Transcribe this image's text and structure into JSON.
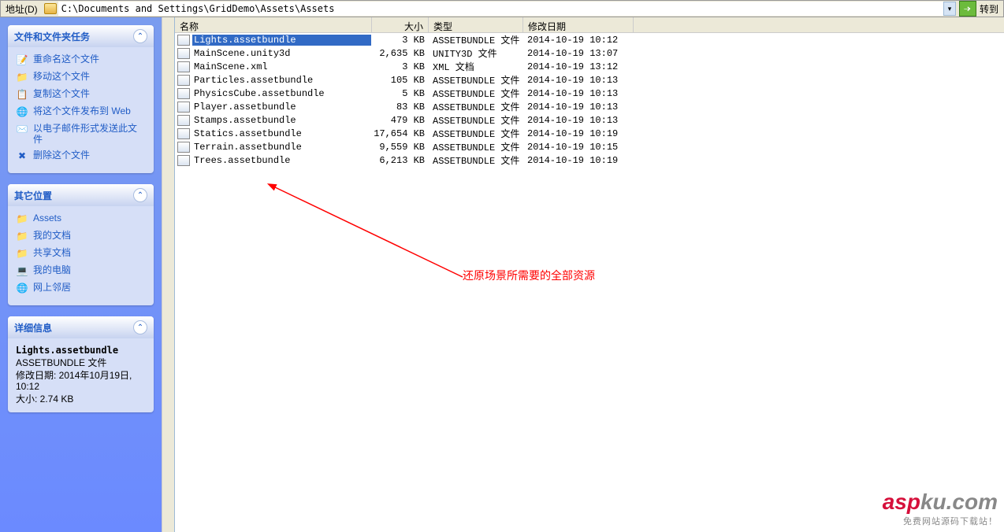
{
  "addrbar": {
    "label": "地址(D)",
    "path": "C:\\Documents and Settings\\GridDemo\\Assets\\Assets",
    "go": "转到"
  },
  "panels": {
    "tasks": {
      "title": "文件和文件夹任务",
      "items": [
        "重命名这个文件",
        "移动这个文件",
        "复制这个文件",
        "将这个文件发布到 Web",
        "以电子邮件形式发送此文件",
        "删除这个文件"
      ]
    },
    "places": {
      "title": "其它位置",
      "items": [
        "Assets",
        "我的文档",
        "共享文档",
        "我的电脑",
        "网上邻居"
      ]
    },
    "details": {
      "title": "详细信息",
      "filename": "Lights.assetbundle",
      "filetype": "ASSETBUNDLE 文件",
      "modlabel": "修改日期: 2014年10月19日, 10:12",
      "sizelabel": "大小: 2.74 KB"
    }
  },
  "columns": {
    "name": "名称",
    "size": "大小",
    "type": "类型",
    "date": "修改日期"
  },
  "files": [
    {
      "name": "Lights.assetbundle",
      "size": "3 KB",
      "type": "ASSETBUNDLE 文件",
      "date": "2014-10-19 10:12",
      "sel": true
    },
    {
      "name": "MainScene.unity3d",
      "size": "2,635 KB",
      "type": "UNITY3D 文件",
      "date": "2014-10-19 13:07"
    },
    {
      "name": "MainScene.xml",
      "size": "3 KB",
      "type": "XML 文档",
      "date": "2014-10-19 13:12"
    },
    {
      "name": "Particles.assetbundle",
      "size": "105 KB",
      "type": "ASSETBUNDLE 文件",
      "date": "2014-10-19 10:13"
    },
    {
      "name": "PhysicsCube.assetbundle",
      "size": "5 KB",
      "type": "ASSETBUNDLE 文件",
      "date": "2014-10-19 10:13"
    },
    {
      "name": "Player.assetbundle",
      "size": "83 KB",
      "type": "ASSETBUNDLE 文件",
      "date": "2014-10-19 10:13"
    },
    {
      "name": "Stamps.assetbundle",
      "size": "479 KB",
      "type": "ASSETBUNDLE 文件",
      "date": "2014-10-19 10:13"
    },
    {
      "name": "Statics.assetbundle",
      "size": "17,654 KB",
      "type": "ASSETBUNDLE 文件",
      "date": "2014-10-19 10:19"
    },
    {
      "name": "Terrain.assetbundle",
      "size": "9,559 KB",
      "type": "ASSETBUNDLE 文件",
      "date": "2014-10-19 10:15"
    },
    {
      "name": "Trees.assetbundle",
      "size": "6,213 KB",
      "type": "ASSETBUNDLE 文件",
      "date": "2014-10-19 10:19"
    }
  ],
  "annotation": "还原场景所需要的全部资源",
  "watermark": {
    "brand_a": "asp",
    "brand_b": "ku",
    "brand_c": ".com",
    "tag": "免费网站源码下载站！"
  }
}
